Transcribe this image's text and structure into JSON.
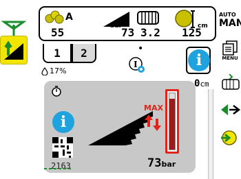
{
  "left_column": {
    "top_icon": "tractor-level-icon",
    "active_icon": "crop-height-icon"
  },
  "info_bar": {
    "crop_label": "A",
    "crop_value": "55",
    "pressure_unit": "bar",
    "pressure_value": "73",
    "bale_value": "3.2",
    "height_unit": "cm",
    "height_value": "125"
  },
  "tabs": [
    {
      "label": "1"
    },
    {
      "label": "2"
    }
  ],
  "moisture": "17%",
  "center_dot": "•",
  "height_readout": {
    "value": "0",
    "unit": "cm"
  },
  "main_card": {
    "qr_code_number": "2163",
    "max_label": "MAX",
    "pressure_value": "73",
    "pressure_unit": "bar",
    "level_fraction": 0.9
  },
  "right_column": {
    "mode_line1": "AUTO",
    "mode_line2": "MAN",
    "menu_label": "MENU"
  },
  "colors": {
    "info_blue": "#1fa3df",
    "warning_red": "#e2231a",
    "active_yellow": "#f2e500",
    "card_grey": "#c8c8c8",
    "green": "#1c8c2c"
  }
}
